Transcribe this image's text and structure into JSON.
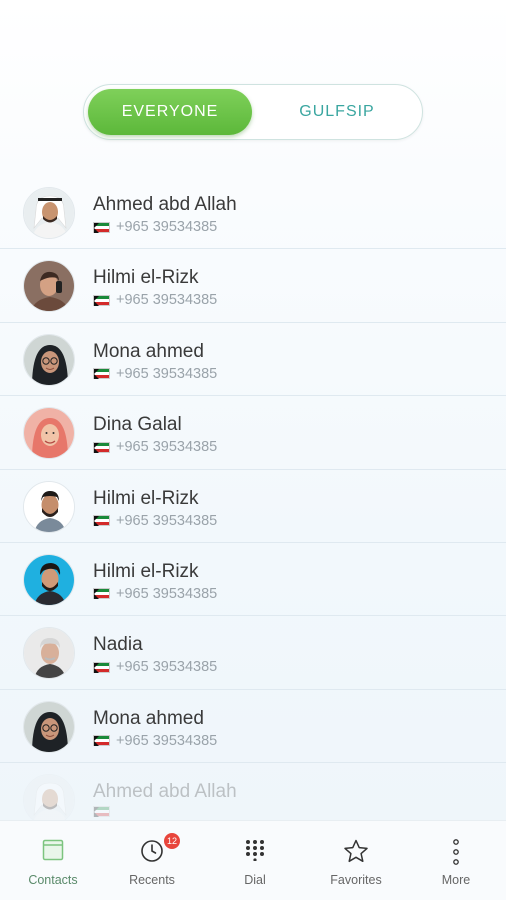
{
  "segments": {
    "everyone": "EVERYONE",
    "gulfsip": "GULFSIP"
  },
  "contacts": [
    {
      "name": "Ahmed abd Allah",
      "phone": "+965 39534385",
      "avatar": "man-ghutra-avatar"
    },
    {
      "name": "Hilmi el-Rizk",
      "phone": "+965 39534385",
      "avatar": "man-phone-avatar"
    },
    {
      "name": "Mona ahmed",
      "phone": "+965 39534385",
      "avatar": "woman-hijab-glasses-avatar"
    },
    {
      "name": "Dina Galal",
      "phone": "+965 39534385",
      "avatar": "woman-hijab-pink-avatar"
    },
    {
      "name": "Hilmi el-Rizk",
      "phone": "+965 39534385",
      "avatar": "man-beard-avatar"
    },
    {
      "name": "Hilmi el-Rizk",
      "phone": "+965 39534385",
      "avatar": "man-blue-bg-avatar"
    },
    {
      "name": "Nadia",
      "phone": "+965 39534385",
      "avatar": "older-man-avatar"
    },
    {
      "name": "Mona ahmed",
      "phone": "+965 39534385",
      "avatar": "woman-hijab-glasses-avatar"
    },
    {
      "name": "Ahmed abd Allah",
      "phone": "",
      "avatar": "man-ghutra-avatar"
    }
  ],
  "tabs": {
    "contacts": "Contacts",
    "recents": "Recents",
    "recents_badge": "12",
    "dial": "Dial",
    "favorites": "Favorites",
    "more": "More"
  },
  "colors": {
    "accent_green": "#5cb83a",
    "teal_text": "#3aa6a0",
    "badge_red": "#e8453c"
  }
}
